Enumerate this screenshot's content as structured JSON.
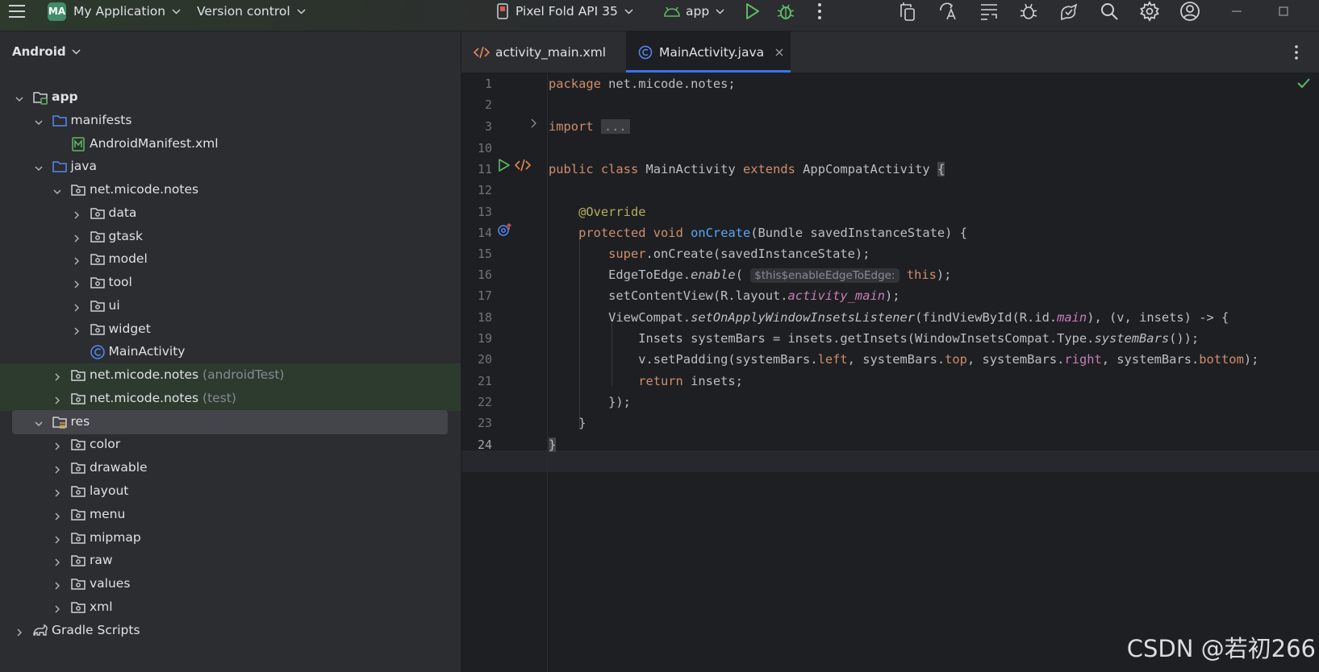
{
  "topbar": {
    "project_badge": "MA",
    "project_name": "My Application",
    "vcs": "Version control",
    "device": "Pixel Fold API 35",
    "run_config": "app"
  },
  "project": {
    "view": "Android",
    "tree": [
      {
        "label": "app",
        "suffix": ""
      },
      {
        "label": "manifests",
        "suffix": ""
      },
      {
        "label": "AndroidManifest.xml",
        "suffix": ""
      },
      {
        "label": "java",
        "suffix": ""
      },
      {
        "label": "net.micode.notes",
        "suffix": ""
      },
      {
        "label": "data",
        "suffix": ""
      },
      {
        "label": "gtask",
        "suffix": ""
      },
      {
        "label": "model",
        "suffix": ""
      },
      {
        "label": "tool",
        "suffix": ""
      },
      {
        "label": "ui",
        "suffix": ""
      },
      {
        "label": "widget",
        "suffix": ""
      },
      {
        "label": "MainActivity",
        "suffix": ""
      },
      {
        "label": "net.micode.notes",
        "suffix": "(androidTest)"
      },
      {
        "label": "net.micode.notes",
        "suffix": "(test)"
      },
      {
        "label": "res",
        "suffix": ""
      },
      {
        "label": "color",
        "suffix": ""
      },
      {
        "label": "drawable",
        "suffix": ""
      },
      {
        "label": "layout",
        "suffix": ""
      },
      {
        "label": "menu",
        "suffix": ""
      },
      {
        "label": "mipmap",
        "suffix": ""
      },
      {
        "label": "raw",
        "suffix": ""
      },
      {
        "label": "values",
        "suffix": ""
      },
      {
        "label": "xml",
        "suffix": ""
      },
      {
        "label": "Gradle Scripts",
        "suffix": ""
      }
    ]
  },
  "tabs": [
    {
      "label": "activity_main.xml"
    },
    {
      "label": "MainActivity.java"
    }
  ],
  "editor": {
    "line_numbers": [
      "1",
      "2",
      "3",
      "10",
      "11",
      "12",
      "13",
      "14",
      "15",
      "16",
      "17",
      "18",
      "19",
      "20",
      "21",
      "22",
      "23",
      "24"
    ],
    "c": {
      "l1_kw": "package",
      "l1_rest": " net.micode.notes;",
      "l3_kw": "import",
      "l3_fold": "...",
      "l11_kw1": "public",
      "l11_kw2": "class",
      "l11_name": "MainActivity",
      "l11_kw3": "extends",
      "l11_super": "AppCompatActivity",
      "l11_brace": "{",
      "l13_ann": "@Override",
      "l14_kw1": "protected",
      "l14_kw2": "void",
      "l14_fn": "onCreate",
      "l14_rest": "(Bundle savedInstanceState) {",
      "l15_kw": "super",
      "l15_rest": ".onCreate(savedInstanceState);",
      "l16_a": "EdgeToEdge.",
      "l16_b": "enable",
      "l16_c": "(",
      "l16_hint": "$this$enableEdgeToEdge:",
      "l16_kw": "this",
      "l16_d": ");",
      "l17_a": "setContentView(R.layout.",
      "l17_b": "activity_main",
      "l17_c": ");",
      "l18_a": "ViewCompat.",
      "l18_b": "setOnApplyWindowInsetsListener",
      "l18_c": "(findViewById(R.id.",
      "l18_d": "main",
      "l18_e": "), (v, insets) -> {",
      "l19_a": "Insets systemBars = insets.getInsets(WindowInsetsCompat.Type.",
      "l19_b": "systemBars",
      "l19_c": "());",
      "l20_a": "v.setPadding(systemBars.",
      "l20_b": "left",
      "l20_c": ", systemBars.",
      "l20_d": "top",
      "l20_e": ", systemBars.",
      "l20_f": "right",
      "l20_g": ", systemBars.",
      "l20_h": "bottom",
      "l20_i": ");",
      "l21_kw": "return",
      "l21_rest": " insets;",
      "l22": "});",
      "l23": "}",
      "l24": "}"
    }
  },
  "watermark": "CSDN @若初266"
}
